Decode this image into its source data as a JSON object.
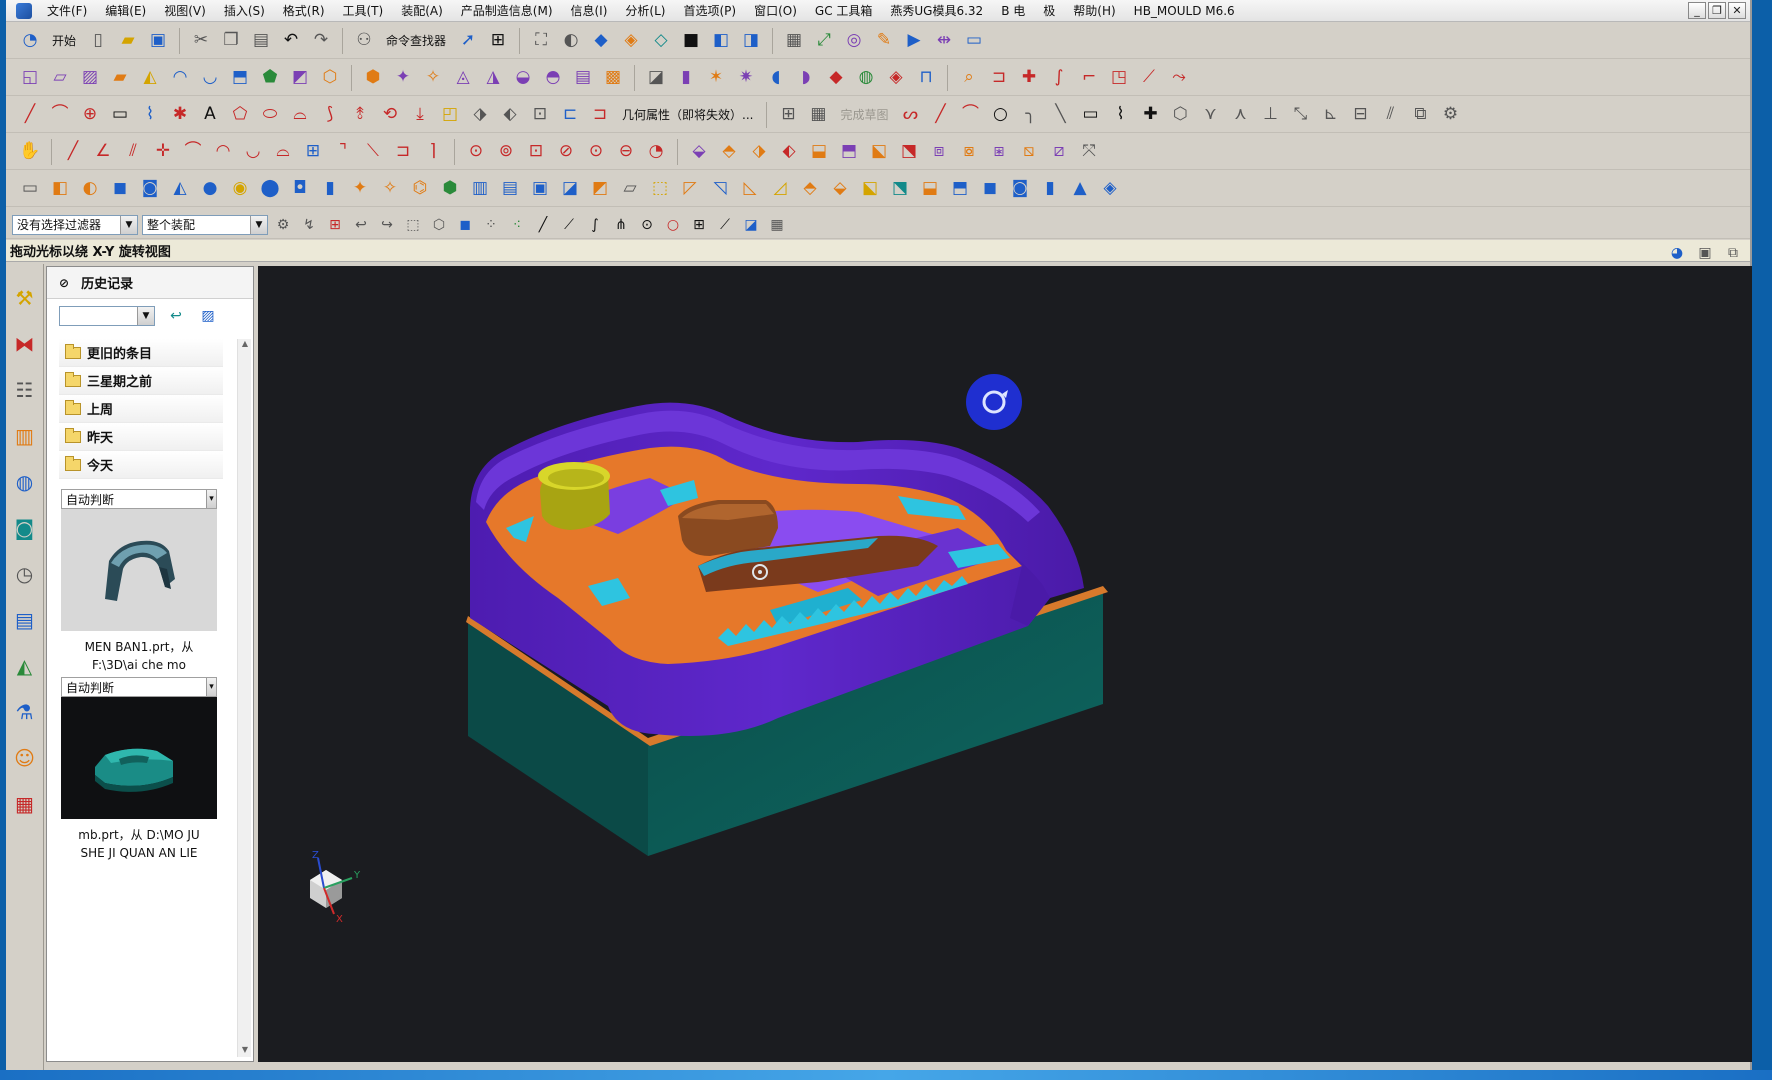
{
  "menubar": {
    "items": [
      "文件(F)",
      "编辑(E)",
      "视图(V)",
      "插入(S)",
      "格式(R)",
      "工具(T)",
      "装配(A)",
      "产品制造信息(M)",
      "信息(I)",
      "分析(L)",
      "首选项(P)",
      "窗口(O)",
      "GC 工具箱",
      "燕秀UG模具6.32",
      "B 电",
      "极",
      "帮助(H)",
      "HB_MOULD M6.6"
    ],
    "window_controls": [
      "_",
      "❐",
      "✕"
    ]
  },
  "toolbar1": {
    "start_label": "开始",
    "command_finder_label": "命令查找器"
  },
  "toolbar3": {
    "geometry_props_label": "几何属性（即将失效）...",
    "finish_sketch_label": "完成草图"
  },
  "filterbar": {
    "selection_filter": "没有选择过滤器",
    "assembly_scope": "整个装配"
  },
  "statusbar": {
    "cue": "拖动光标以绕 X-Y 旋转视图"
  },
  "history": {
    "title": "历史记录",
    "groups": [
      "更旧的条目",
      "三星期之前",
      "上周",
      "昨天",
      "今天"
    ],
    "entries": [
      {
        "mode": "自动判断",
        "caption_line1": "MEN BAN1.prt，从",
        "caption_line2": "F:\\3D\\ai che mo"
      },
      {
        "mode": "自动判断",
        "caption_line1": "mb.prt，从 D:\\MO  JU",
        "caption_line2": "SHE  JI  QUAN  AN LIE"
      }
    ]
  },
  "viewport": {
    "triad_labels": {
      "x": "X",
      "y": "Y",
      "z": "Z"
    },
    "colors": {
      "background": "#1b1c20",
      "mold_wall": "#5a22c4",
      "mold_base": "#0e5a55",
      "part_orange": "#e6782a",
      "part_cyan": "#2ec4e0",
      "insert_yellow": "#c8c81e",
      "rotate_cursor": "#1f2fd0"
    }
  }
}
